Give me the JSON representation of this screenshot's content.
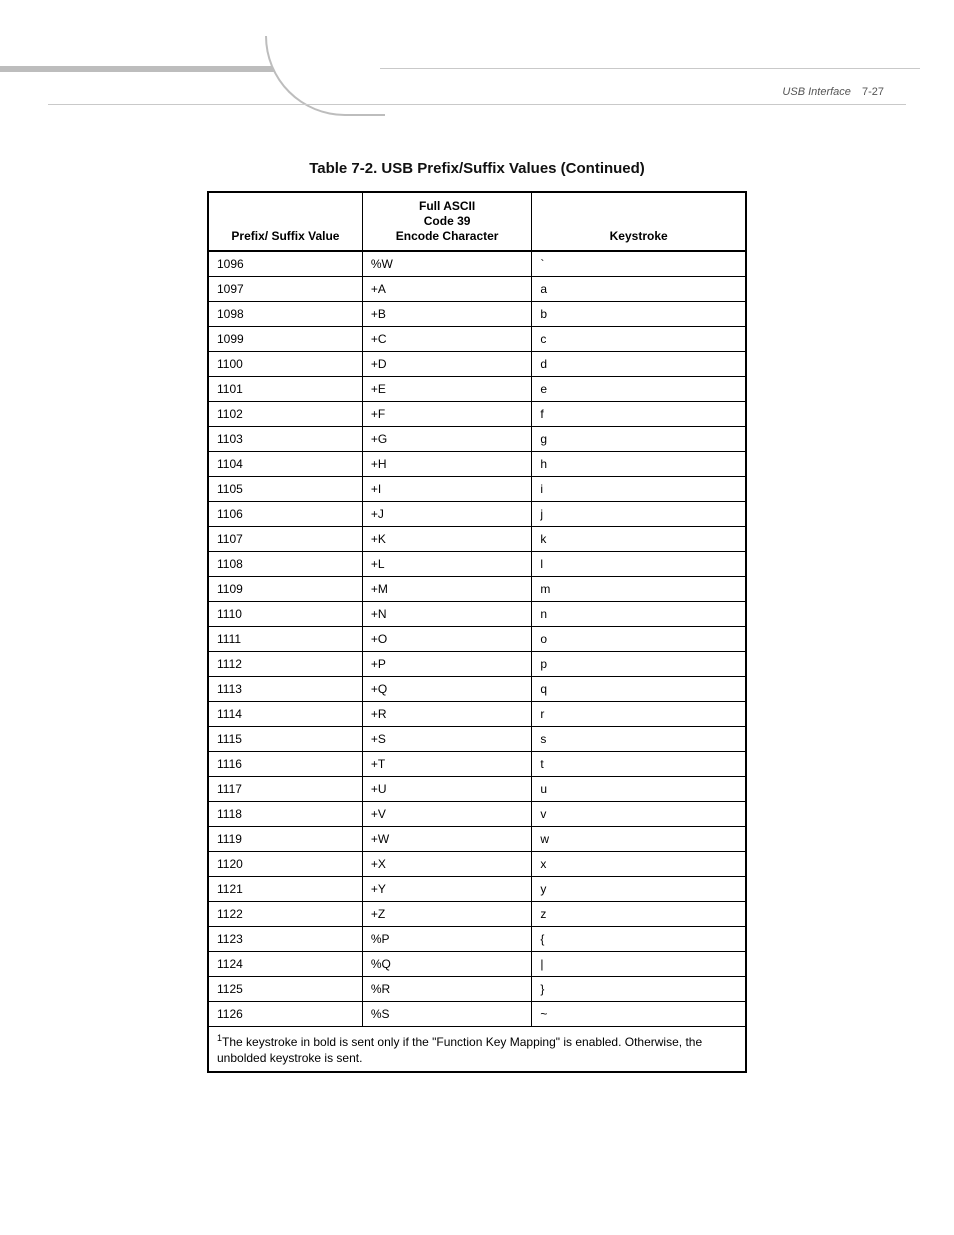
{
  "header": {
    "section": "USB Interface",
    "page": "7-27"
  },
  "caption": "Table 7-2. USB Prefix/Suffix Values (Continued)",
  "columns": {
    "c1": "Prefix/ Suffix Value",
    "c2_line1": "Full ASCII",
    "c2_line2": "Code 39",
    "c2_line3": "Encode Character",
    "c3": "Keystroke"
  },
  "rows": [
    {
      "v": "1096",
      "e": "%W",
      "k": "`"
    },
    {
      "v": "1097",
      "e": "+A",
      "k": "a"
    },
    {
      "v": "1098",
      "e": "+B",
      "k": "b"
    },
    {
      "v": "1099",
      "e": "+C",
      "k": "c"
    },
    {
      "v": "1100",
      "e": "+D",
      "k": "d"
    },
    {
      "v": "1101",
      "e": "+E",
      "k": "e"
    },
    {
      "v": "1102",
      "e": "+F",
      "k": "f"
    },
    {
      "v": "1103",
      "e": "+G",
      "k": "g"
    },
    {
      "v": "1104",
      "e": "+H",
      "k": "h"
    },
    {
      "v": "1105",
      "e": "+I",
      "k": "i"
    },
    {
      "v": "1106",
      "e": "+J",
      "k": "j"
    },
    {
      "v": "1107",
      "e": "+K",
      "k": "k"
    },
    {
      "v": "1108",
      "e": "+L",
      "k": "l"
    },
    {
      "v": "1109",
      "e": "+M",
      "k": "m"
    },
    {
      "v": "1110",
      "e": "+N",
      "k": "n"
    },
    {
      "v": "1111",
      "e": "+O",
      "k": "o"
    },
    {
      "v": "1112",
      "e": "+P",
      "k": "p"
    },
    {
      "v": "1113",
      "e": "+Q",
      "k": "q"
    },
    {
      "v": "1114",
      "e": "+R",
      "k": "r"
    },
    {
      "v": "1115",
      "e": "+S",
      "k": "s"
    },
    {
      "v": "1116",
      "e": "+T",
      "k": "t"
    },
    {
      "v": "1117",
      "e": "+U",
      "k": "u"
    },
    {
      "v": "1118",
      "e": "+V",
      "k": "v"
    },
    {
      "v": "1119",
      "e": "+W",
      "k": "w"
    },
    {
      "v": "1120",
      "e": "+X",
      "k": "x"
    },
    {
      "v": "1121",
      "e": "+Y",
      "k": "y"
    },
    {
      "v": "1122",
      "e": "+Z",
      "k": "z"
    },
    {
      "v": "1123",
      "e": "%P",
      "k": "{"
    },
    {
      "v": "1124",
      "e": "%Q",
      "k": "|"
    },
    {
      "v": "1125",
      "e": "%R",
      "k": "}"
    },
    {
      "v": "1126",
      "e": "%S",
      "k": "~"
    }
  ],
  "footnote": "The keystroke in bold is sent only if the \"Function Key Mapping\" is enabled. Otherwise, the unbolded keystroke is sent."
}
